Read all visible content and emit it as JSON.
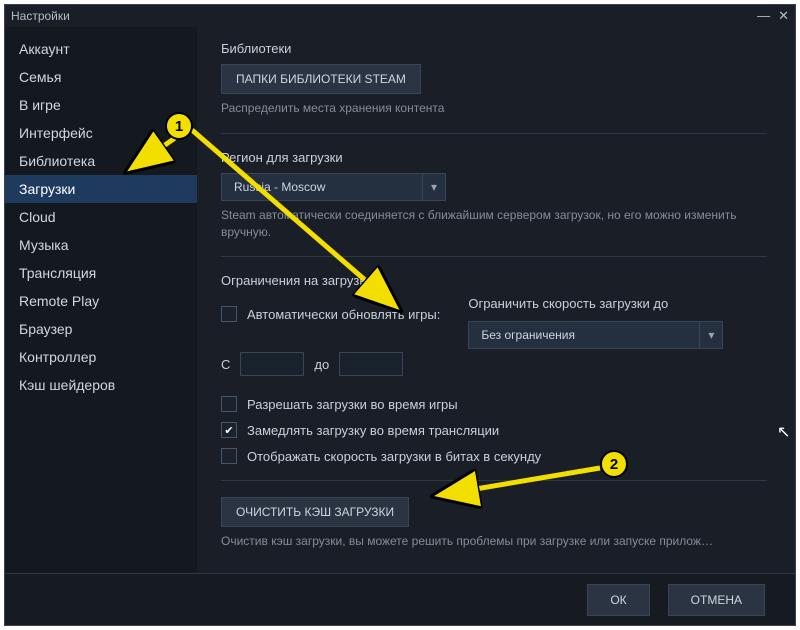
{
  "window": {
    "title": "Настройки"
  },
  "sidebar": {
    "items": [
      {
        "label": "Аккаунт"
      },
      {
        "label": "Семья"
      },
      {
        "label": "В игре"
      },
      {
        "label": "Интерфейс"
      },
      {
        "label": "Библиотека"
      },
      {
        "label": "Загрузки"
      },
      {
        "label": "Cloud"
      },
      {
        "label": "Музыка"
      },
      {
        "label": "Трансляция"
      },
      {
        "label": "Remote Play"
      },
      {
        "label": "Браузер"
      },
      {
        "label": "Контроллер"
      },
      {
        "label": "Кэш шейдеров"
      }
    ]
  },
  "content": {
    "lib_title": "Библиотеки",
    "lib_button": "ПАПКИ БИБЛИОТЕКИ STEAM",
    "lib_desc": "Распределить места хранения контента",
    "region_title": "Регион для загрузки",
    "region_value": "Russia - Moscow",
    "region_desc": "Steam автоматически соединяется с ближайшим сервером загрузок, но его можно изменить вручную.",
    "restrict_title": "Ограничения на загрузку",
    "auto_update_label": "Автоматически обновлять игры:",
    "from_label": "С",
    "to_label": "до",
    "limit_label": "Ограничить скорость загрузки до",
    "limit_value": "Без ограничения",
    "allow_ingame": "Разрешать загрузки во время игры",
    "throttle_stream": "Замедлять загрузку во время трансляции",
    "show_bits": "Отображать скорость загрузки в битах в секунду",
    "clear_cache_btn": "ОЧИСТИТЬ КЭШ ЗАГРУЗКИ",
    "clear_cache_desc": "Очистив кэш загрузки, вы можете решить проблемы при загрузке или запуске прилож…"
  },
  "footer": {
    "ok": "ОК",
    "cancel": "ОТМЕНА"
  },
  "annotations": {
    "one": "1",
    "two": "2"
  }
}
